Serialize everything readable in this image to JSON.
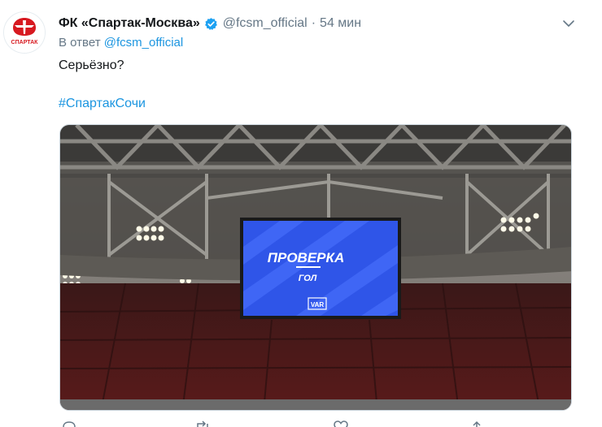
{
  "tweet": {
    "display_name": "ФК «Спартак-Москва»",
    "handle": "@fcsm_official",
    "separator": "·",
    "time": "54 мин",
    "reply_prefix": "В ответ",
    "reply_to": "@fcsm_official",
    "text": "Серьёзно?",
    "hashtag": "#СпартакСочи",
    "avatar_label": "СПАРТАК"
  },
  "media": {
    "screen_title": "ПРОВЕРКА",
    "screen_subtitle": "ГОЛ",
    "screen_badge": "VAR"
  },
  "icons": {
    "verified": "verified-badge-icon",
    "menu": "chevron-down-icon",
    "reply": "reply-icon",
    "retweet": "retweet-icon",
    "like": "heart-icon",
    "share": "share-icon"
  },
  "colors": {
    "link": "#1b95e0",
    "verified": "#1da1f2",
    "muted": "#657786",
    "club_red": "#d71920",
    "screen_blue": "#2f55e8"
  }
}
